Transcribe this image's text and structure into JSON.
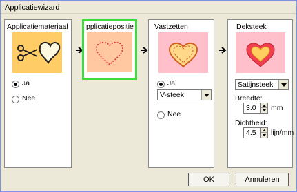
{
  "window": {
    "title": "Applicatiewizard"
  },
  "panels": [
    {
      "title": "Applicatiemateriaal"
    },
    {
      "title": "pplicatiepositie"
    },
    {
      "title": "Vastzetten"
    },
    {
      "title": "Deksteek"
    }
  ],
  "panel1": {
    "yes_label": "Ja",
    "no_label": "Nee",
    "selected": "Ja"
  },
  "panel3": {
    "yes_label": "Ja",
    "no_label": "Nee",
    "selected": "Ja",
    "stitch_type": "V-steek"
  },
  "panel4": {
    "stitch_type": "Satijnsteek",
    "width_label": "Breedte:",
    "width_value": "3.0",
    "width_unit": "mm",
    "density_label": "Dichtheid:",
    "density_value": "4.5",
    "density_unit": "lijn/mm"
  },
  "buttons": {
    "ok": "OK",
    "cancel": "Annuleren"
  },
  "colors": {
    "panel1_image_bg": "#ffcc66",
    "panel2_image_bg": "#ffc8a0",
    "panel3_image_bg": "#ffc0cc",
    "panel4_image_bg": "#ffc0cc",
    "selected_border": "#3cdc3c"
  },
  "icons": [
    "scissors-icon",
    "heart-outline-icon",
    "dotted-heart-icon",
    "zigzag-heart-icon",
    "satin-heart-icon",
    "arrow-right-icon",
    "chevron-down-icon"
  ]
}
